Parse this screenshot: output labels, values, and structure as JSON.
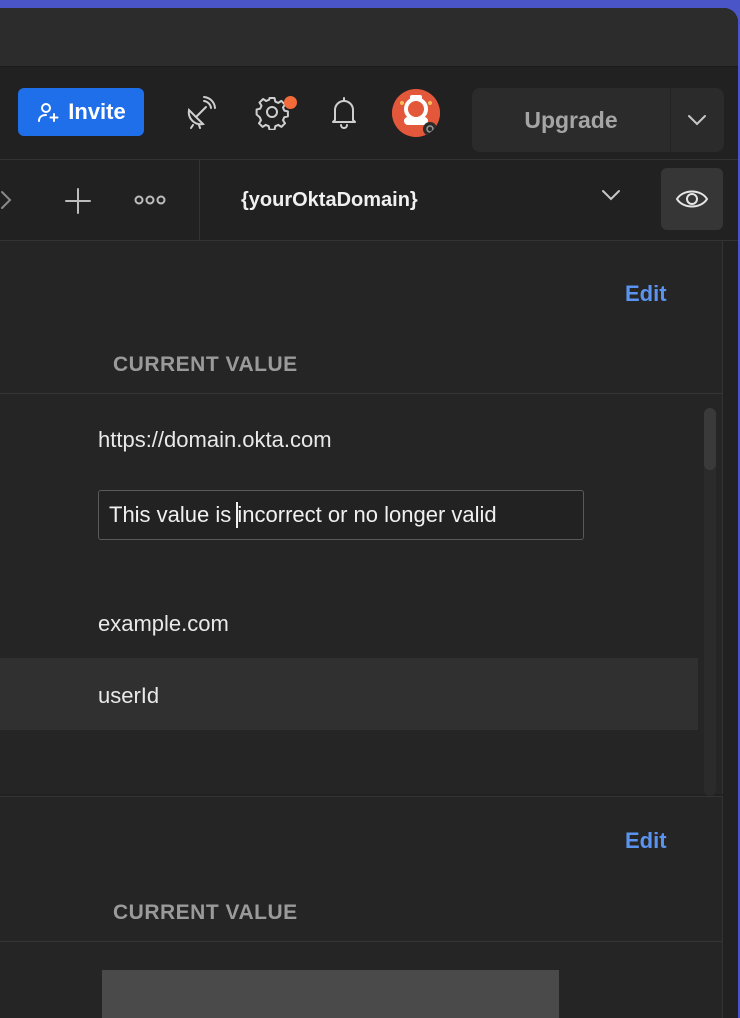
{
  "header": {
    "invite_label": "Invite",
    "upgrade_label": "Upgrade",
    "icons": [
      "add-user-icon",
      "satellite-icon",
      "gear-icon",
      "bell-icon",
      "chevron-down-icon"
    ],
    "accent_color": "#1f6feb",
    "notification_color": "#f26b3a"
  },
  "toolbar": {
    "environment_label": "{yourOktaDomain}",
    "icons": [
      "chevron-right-icon",
      "plus-icon",
      "more-icon",
      "chevron-down-icon",
      "eye-icon"
    ]
  },
  "panel1": {
    "edit_label": "Edit",
    "column_header": "CURRENT VALUE",
    "rows": {
      "r1": "https://domain.okta.com",
      "input_before_cursor": "This value is ",
      "input_after_cursor": "incorrect or no longer valid",
      "r3": "example.com",
      "r4": "userId"
    }
  },
  "panel2": {
    "edit_label": "Edit",
    "column_header": "CURRENT VALUE"
  }
}
